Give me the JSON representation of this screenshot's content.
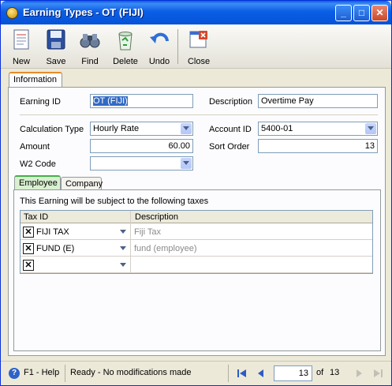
{
  "window": {
    "title": "Earning Types - OT (FIJI)",
    "minimize": "_",
    "maximize": "□",
    "close": "✕"
  },
  "toolbar": {
    "new": "New",
    "save": "Save",
    "find": "Find",
    "delete": "Delete",
    "undo": "Undo",
    "close": "Close"
  },
  "tabs": {
    "information": "Information"
  },
  "form": {
    "earning_id_label": "Earning ID",
    "earning_id_value": "OT (FIJI)",
    "description_label": "Description",
    "description_value": "Overtime Pay",
    "calc_type_label": "Calculation Type",
    "calc_type_value": "Hourly Rate",
    "account_id_label": "Account ID",
    "account_id_value": "5400-01",
    "amount_label": "Amount",
    "amount_value": "60.00",
    "sort_order_label": "Sort Order",
    "sort_order_value": "13",
    "w2_code_label": "W2 Code",
    "w2_code_value": ""
  },
  "subtabs": {
    "employee": "Employee",
    "company": "Company"
  },
  "taxes": {
    "intro": "This Earning will be subject to the following taxes",
    "col_tax_id": "Tax ID",
    "col_description": "Description",
    "rows": [
      {
        "tax_id": "FIJI TAX",
        "description": "Fiji Tax"
      },
      {
        "tax_id": "FUND (E)",
        "description": "fund (employee)"
      },
      {
        "tax_id": "",
        "description": ""
      }
    ],
    "remove_glyph": "✕"
  },
  "status": {
    "help": "F1 - Help",
    "message": "Ready - No modifications made",
    "page": "13",
    "of": "of",
    "total": "13"
  },
  "colors": {
    "title_bar": "#0b5ee6",
    "selection": "#316ac5",
    "tab_accent": "#e68b2c",
    "subtab_accent": "#45b04a"
  }
}
